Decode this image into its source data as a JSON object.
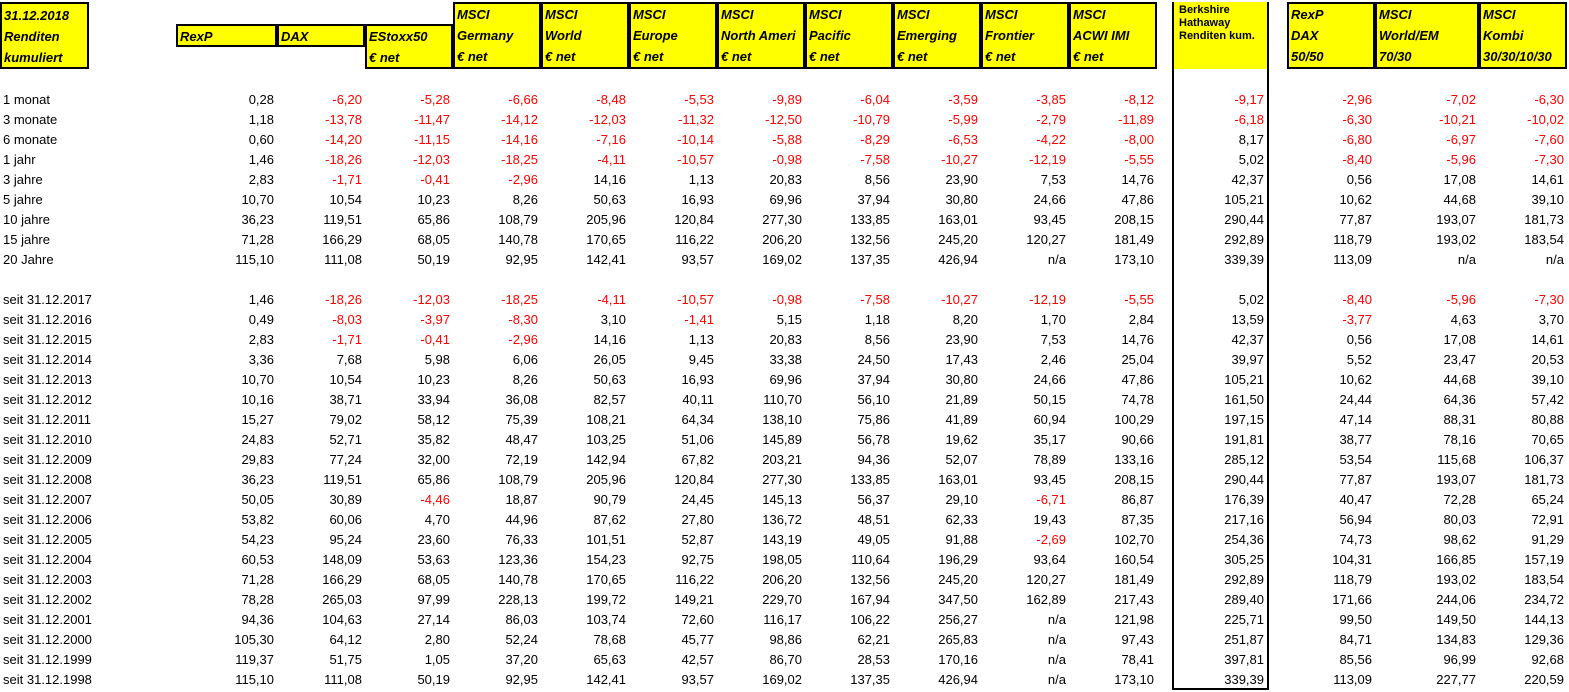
{
  "top_left": [
    "31.12.2018",
    "Renditen",
    "kumuliert"
  ],
  "headers": [
    [
      "RexP"
    ],
    [
      "DAX"
    ],
    [
      "EStoxx50",
      "€ net"
    ],
    [
      "MSCI",
      "Germany",
      "€ net"
    ],
    [
      "MSCI",
      "World",
      "€ net"
    ],
    [
      "MSCI",
      "Europe",
      "€ net"
    ],
    [
      "MSCI",
      "North Ameri",
      "€ net"
    ],
    [
      "MSCI",
      "Pacific",
      "€ net"
    ],
    [
      "MSCI",
      "Emerging",
      "€ net"
    ],
    [
      "MSCI",
      "Frontier",
      "€ net"
    ],
    [
      "MSCI",
      "ACWI IMI",
      "€ net"
    ]
  ],
  "berkshire_header": [
    "Berkshire",
    "Hathaway",
    "Renditen kum."
  ],
  "right_headers": [
    [
      "RexP",
      "DAX",
      "50/50"
    ],
    [
      "MSCI",
      "World/EM",
      "70/30"
    ],
    [
      "MSCI",
      "Kombi",
      "30/30/10/30"
    ]
  ],
  "colors": {
    "header_bg": "#ffff00",
    "negative": "#ff0000",
    "positive": "#000000"
  },
  "groups": [
    {
      "rows": [
        {
          "label": "1 monat",
          "values": [
            "0,28",
            "-6,20",
            "-5,28",
            "-6,66",
            "-8,48",
            "-5,53",
            "-9,89",
            "-6,04",
            "-3,59",
            "-3,85",
            "-8,12"
          ],
          "berkshire": "-9,17",
          "right": [
            "-2,96",
            "-7,02",
            "-6,30"
          ]
        },
        {
          "label": "3 monate",
          "values": [
            "1,18",
            "-13,78",
            "-11,47",
            "-14,12",
            "-12,03",
            "-11,32",
            "-12,50",
            "-10,79",
            "-5,99",
            "-2,79",
            "-11,89"
          ],
          "berkshire": "-6,18",
          "right": [
            "-6,30",
            "-10,21",
            "-10,02"
          ]
        },
        {
          "label": "6 monate",
          "values": [
            "0,60",
            "-14,20",
            "-11,15",
            "-14,16",
            "-7,16",
            "-10,14",
            "-5,88",
            "-8,29",
            "-6,53",
            "-4,22",
            "-8,00"
          ],
          "berkshire": "8,17",
          "right": [
            "-6,80",
            "-6,97",
            "-7,60"
          ]
        },
        {
          "label": "1 jahr",
          "values": [
            "1,46",
            "-18,26",
            "-12,03",
            "-18,25",
            "-4,11",
            "-10,57",
            "-0,98",
            "-7,58",
            "-10,27",
            "-12,19",
            "-5,55"
          ],
          "berkshire": "5,02",
          "right": [
            "-8,40",
            "-5,96",
            "-7,30"
          ]
        },
        {
          "label": "3 jahre",
          "values": [
            "2,83",
            "-1,71",
            "-0,41",
            "-2,96",
            "14,16",
            "1,13",
            "20,83",
            "8,56",
            "23,90",
            "7,53",
            "14,76"
          ],
          "berkshire": "42,37",
          "right": [
            "0,56",
            "17,08",
            "14,61"
          ]
        },
        {
          "label": "5 jahre",
          "values": [
            "10,70",
            "10,54",
            "10,23",
            "8,26",
            "50,63",
            "16,93",
            "69,96",
            "37,94",
            "30,80",
            "24,66",
            "47,86"
          ],
          "berkshire": "105,21",
          "right": [
            "10,62",
            "44,68",
            "39,10"
          ]
        },
        {
          "label": "10 jahre",
          "values": [
            "36,23",
            "119,51",
            "65,86",
            "108,79",
            "205,96",
            "120,84",
            "277,30",
            "133,85",
            "163,01",
            "93,45",
            "208,15"
          ],
          "berkshire": "290,44",
          "right": [
            "77,87",
            "193,07",
            "181,73"
          ]
        },
        {
          "label": "15 jahre",
          "values": [
            "71,28",
            "166,29",
            "68,05",
            "140,78",
            "170,65",
            "116,22",
            "206,20",
            "132,56",
            "245,20",
            "120,27",
            "181,49"
          ],
          "berkshire": "292,89",
          "right": [
            "118,79",
            "193,02",
            "183,54"
          ]
        },
        {
          "label": "20 Jahre",
          "values": [
            "115,10",
            "111,08",
            "50,19",
            "92,95",
            "142,41",
            "93,57",
            "169,02",
            "137,35",
            "426,94",
            "n/a",
            "173,10"
          ],
          "berkshire": "339,39",
          "right": [
            "113,09",
            "n/a",
            "n/a"
          ]
        }
      ]
    },
    {
      "rows": [
        {
          "label": "seit 31.12.2017",
          "values": [
            "1,46",
            "-18,26",
            "-12,03",
            "-18,25",
            "-4,11",
            "-10,57",
            "-0,98",
            "-7,58",
            "-10,27",
            "-12,19",
            "-5,55"
          ],
          "berkshire": "5,02",
          "right": [
            "-8,40",
            "-5,96",
            "-7,30"
          ]
        },
        {
          "label": "seit 31.12.2016",
          "values": [
            "0,49",
            "-8,03",
            "-3,97",
            "-8,30",
            "3,10",
            "-1,41",
            "5,15",
            "1,18",
            "8,20",
            "1,70",
            "2,84"
          ],
          "berkshire": "13,59",
          "right": [
            "-3,77",
            "4,63",
            "3,70"
          ]
        },
        {
          "label": "seit 31.12.2015",
          "values": [
            "2,83",
            "-1,71",
            "-0,41",
            "-2,96",
            "14,16",
            "1,13",
            "20,83",
            "8,56",
            "23,90",
            "7,53",
            "14,76"
          ],
          "berkshire": "42,37",
          "right": [
            "0,56",
            "17,08",
            "14,61"
          ]
        },
        {
          "label": "seit 31.12.2014",
          "values": [
            "3,36",
            "7,68",
            "5,98",
            "6,06",
            "26,05",
            "9,45",
            "33,38",
            "24,50",
            "17,43",
            "2,46",
            "25,04"
          ],
          "berkshire": "39,97",
          "right": [
            "5,52",
            "23,47",
            "20,53"
          ]
        },
        {
          "label": "seit 31.12.2013",
          "values": [
            "10,70",
            "10,54",
            "10,23",
            "8,26",
            "50,63",
            "16,93",
            "69,96",
            "37,94",
            "30,80",
            "24,66",
            "47,86"
          ],
          "berkshire": "105,21",
          "right": [
            "10,62",
            "44,68",
            "39,10"
          ]
        },
        {
          "label": "seit 31.12.2012",
          "values": [
            "10,16",
            "38,71",
            "33,94",
            "36,08",
            "82,57",
            "40,11",
            "110,70",
            "56,10",
            "21,89",
            "50,15",
            "74,78"
          ],
          "berkshire": "161,50",
          "right": [
            "24,44",
            "64,36",
            "57,42"
          ]
        },
        {
          "label": "seit 31.12.2011",
          "values": [
            "15,27",
            "79,02",
            "58,12",
            "75,39",
            "108,21",
            "64,34",
            "138,10",
            "75,86",
            "41,89",
            "60,94",
            "100,29"
          ],
          "berkshire": "197,15",
          "right": [
            "47,14",
            "88,31",
            "80,88"
          ]
        },
        {
          "label": "seit 31.12.2010",
          "values": [
            "24,83",
            "52,71",
            "35,82",
            "48,47",
            "103,25",
            "51,06",
            "145,89",
            "56,78",
            "19,62",
            "35,17",
            "90,66"
          ],
          "berkshire": "191,81",
          "right": [
            "38,77",
            "78,16",
            "70,65"
          ]
        },
        {
          "label": "seit 31.12.2009",
          "values": [
            "29,83",
            "77,24",
            "32,00",
            "72,19",
            "142,94",
            "67,82",
            "203,21",
            "94,36",
            "52,07",
            "78,89",
            "133,16"
          ],
          "berkshire": "285,12",
          "right": [
            "53,54",
            "115,68",
            "106,37"
          ]
        },
        {
          "label": "seit 31.12.2008",
          "values": [
            "36,23",
            "119,51",
            "65,86",
            "108,79",
            "205,96",
            "120,84",
            "277,30",
            "133,85",
            "163,01",
            "93,45",
            "208,15"
          ],
          "berkshire": "290,44",
          "right": [
            "77,87",
            "193,07",
            "181,73"
          ]
        },
        {
          "label": "seit 31.12.2007",
          "values": [
            "50,05",
            "30,89",
            "-4,46",
            "18,87",
            "90,79",
            "24,45",
            "145,13",
            "56,37",
            "29,10",
            "-6,71",
            "86,87"
          ],
          "berkshire": "176,39",
          "right": [
            "40,47",
            "72,28",
            "65,24"
          ]
        },
        {
          "label": "seit 31.12.2006",
          "values": [
            "53,82",
            "60,06",
            "4,70",
            "44,96",
            "87,62",
            "27,80",
            "136,72",
            "48,51",
            "62,33",
            "19,43",
            "87,35"
          ],
          "berkshire": "217,16",
          "right": [
            "56,94",
            "80,03",
            "72,91"
          ]
        },
        {
          "label": "seit 31.12.2005",
          "values": [
            "54,23",
            "95,24",
            "23,60",
            "76,33",
            "101,51",
            "52,87",
            "143,19",
            "49,05",
            "91,88",
            "-2,69",
            "102,70"
          ],
          "berkshire": "254,36",
          "right": [
            "74,73",
            "98,62",
            "91,29"
          ]
        },
        {
          "label": "seit 31.12.2004",
          "values": [
            "60,53",
            "148,09",
            "53,63",
            "123,36",
            "154,23",
            "92,75",
            "198,05",
            "110,64",
            "196,29",
            "93,64",
            "160,54"
          ],
          "berkshire": "305,25",
          "right": [
            "104,31",
            "166,85",
            "157,19"
          ]
        },
        {
          "label": "seit 31.12.2003",
          "values": [
            "71,28",
            "166,29",
            "68,05",
            "140,78",
            "170,65",
            "116,22",
            "206,20",
            "132,56",
            "245,20",
            "120,27",
            "181,49"
          ],
          "berkshire": "292,89",
          "right": [
            "118,79",
            "193,02",
            "183,54"
          ]
        },
        {
          "label": "seit 31.12.2002",
          "values": [
            "78,28",
            "265,03",
            "97,99",
            "228,13",
            "199,72",
            "149,21",
            "229,70",
            "167,94",
            "347,50",
            "162,89",
            "217,43"
          ],
          "berkshire": "289,40",
          "right": [
            "171,66",
            "244,06",
            "234,72"
          ]
        },
        {
          "label": "seit 31.12.2001",
          "values": [
            "94,36",
            "104,63",
            "27,14",
            "86,03",
            "103,74",
            "72,60",
            "116,17",
            "106,22",
            "256,27",
            "n/a",
            "121,98"
          ],
          "berkshire": "225,71",
          "right": [
            "99,50",
            "149,50",
            "144,13"
          ]
        },
        {
          "label": "seit 31.12.2000",
          "values": [
            "105,30",
            "64,12",
            "2,80",
            "52,24",
            "78,68",
            "45,77",
            "98,86",
            "62,21",
            "265,83",
            "n/a",
            "97,43"
          ],
          "berkshire": "251,87",
          "right": [
            "84,71",
            "134,83",
            "129,36"
          ]
        },
        {
          "label": "seit 31.12.1999",
          "values": [
            "119,37",
            "51,75",
            "1,05",
            "37,20",
            "65,63",
            "42,57",
            "86,70",
            "28,53",
            "170,16",
            "n/a",
            "78,41"
          ],
          "berkshire": "397,81",
          "right": [
            "85,56",
            "96,99",
            "92,68"
          ]
        },
        {
          "label": "seit 31.12.1998",
          "values": [
            "115,10",
            "111,08",
            "50,19",
            "92,95",
            "142,41",
            "93,57",
            "169,02",
            "137,35",
            "426,94",
            "n/a",
            "173,10"
          ],
          "berkshire": "339,39",
          "right": [
            "113,09",
            "227,77",
            "220,59"
          ]
        }
      ]
    }
  ]
}
